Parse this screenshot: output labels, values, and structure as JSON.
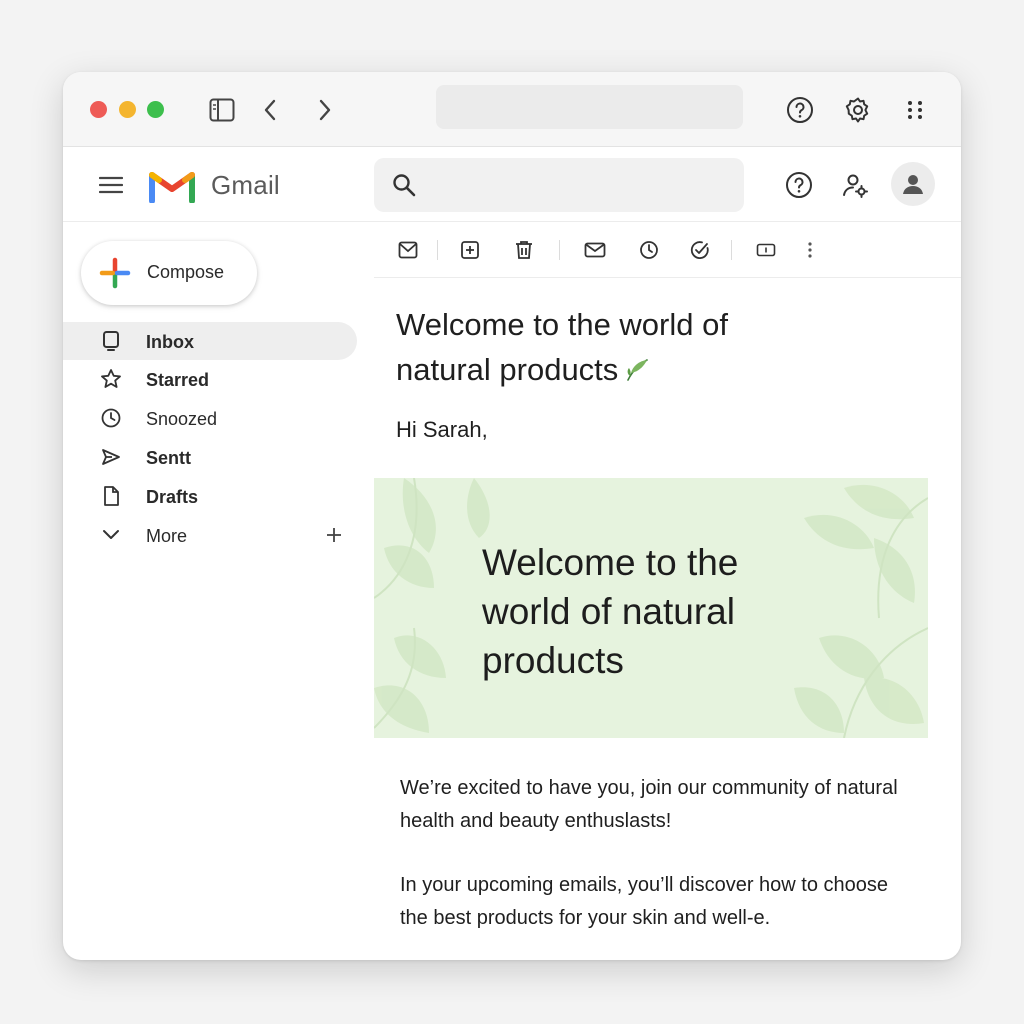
{
  "app": {
    "name": "Gmail",
    "colors": {
      "accent_green_leaf": "#6aa84f",
      "banner_bg": "#e6f3de"
    }
  },
  "chrome": {
    "buttons": [
      "sidebar-toggle-icon",
      "back-icon",
      "forward-icon",
      "help-icon",
      "settings-icon",
      "apps-grid-icon"
    ],
    "url": ""
  },
  "header": {
    "logo_text": "Gmail",
    "search": {
      "value": "",
      "placeholder": ""
    }
  },
  "sidebar": {
    "compose_label": "Compose",
    "items": [
      {
        "label": "Inbox",
        "icon": "inbox-icon",
        "active": true,
        "bold": true
      },
      {
        "label": "Starred",
        "icon": "star-icon",
        "bold": true
      },
      {
        "label": "Snoozed",
        "icon": "clock-icon",
        "bold": false
      },
      {
        "label": "Sentt",
        "icon": "send-icon",
        "bold": true
      },
      {
        "label": "Drafts",
        "icon": "file-icon",
        "bold": true
      },
      {
        "label": "More",
        "icon": "chevron-down-icon",
        "bold": false
      }
    ]
  },
  "toolbar": {
    "icons": [
      "archive-icon",
      "add-to-icon",
      "delete-icon",
      "mark-unread-icon",
      "snooze-icon",
      "add-task-icon",
      "label-icon",
      "more-vert-icon"
    ]
  },
  "email": {
    "subject": "Welcome to the world of natural products",
    "greeting": "Hi Sarah,",
    "banner_title": "Welcome to the world of natural products",
    "paragraphs": [
      "We’re excited to have you, join our community of natural health and beauty enthuslasts!",
      "In your upcoming emails, you’ll discover how to choose the best products for your skin and well-e."
    ]
  }
}
